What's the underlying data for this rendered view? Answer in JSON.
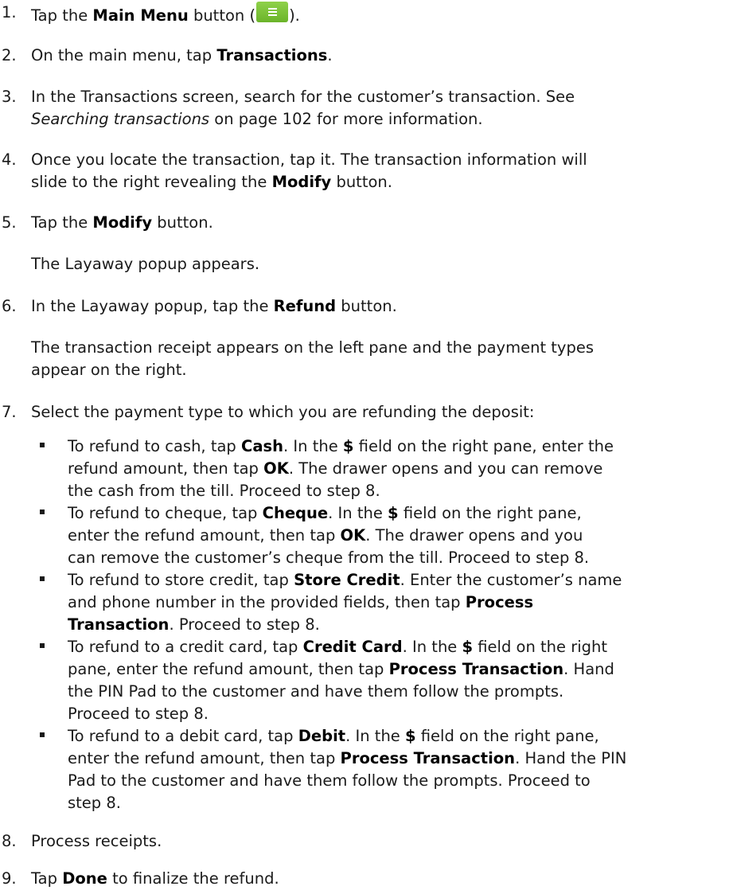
{
  "steps": {
    "s1": {
      "num": "1.",
      "a": "Tap the ",
      "b": "Main Menu",
      "c": " button (",
      "d": ")."
    },
    "s2": {
      "num": "2.",
      "a": "On the main menu, tap ",
      "b": "Transactions",
      "c": "."
    },
    "s3": {
      "num": "3.",
      "a": "In the Transactions screen, search for the customer’s transaction. See",
      "b": "Searching transactions",
      "c": " on page 102 for more information."
    },
    "s4": {
      "num": "4.",
      "a": "Once you locate the transaction, tap it. The transaction information will",
      "b": "slide to the right revealing the ",
      "c": "Modify",
      "d": " button."
    },
    "s5": {
      "num": "5.",
      "a": "Tap the ",
      "b": "Modify",
      "c": " button.",
      "note": "The Layaway popup appears."
    },
    "s6": {
      "num": "6.",
      "a": "In the Layaway popup, tap the ",
      "b": "Refund",
      "c": " button.",
      "note1": "The transaction receipt appears on the left pane and the payment types",
      "note2": "appear on the right."
    },
    "s7": {
      "num": "7.",
      "a": "Select the payment type to which you are refunding the deposit:"
    },
    "s8": {
      "num": "8.",
      "a": "Process receipts."
    },
    "s9": {
      "num": "9.",
      "a": "Tap ",
      "b": "Done",
      "c": " to finalize the refund."
    }
  },
  "bullets": {
    "cash": {
      "l1a": "To refund to cash, tap ",
      "l1b": "Cash",
      "l1c": ". In the ",
      "l1d": "$",
      "l1e": " field on the right pane, enter the",
      "l2a": "refund amount, then tap ",
      "l2b": "OK",
      "l2c": ". The drawer opens and you can remove",
      "l3": "the cash from the till. Proceed to step 8."
    },
    "cheque": {
      "l1a": "To refund to cheque, tap ",
      "l1b": "Cheque",
      "l1c": ". In the ",
      "l1d": "$",
      "l1e": " field on the right pane,",
      "l2a": "enter the refund amount, then tap ",
      "l2b": "OK",
      "l2c": ". The drawer opens and you",
      "l3": "can remove the customer’s cheque from the till. Proceed to step 8."
    },
    "store": {
      "l1a": "To refund to store credit, tap ",
      "l1b": "Store Credit",
      "l1c": ". Enter the customer’s name",
      "l2a": "and phone number in the provided fields, then tap ",
      "l2b": "Process",
      "l3a": "Transaction",
      "l3b": ". Proceed to step 8."
    },
    "credit": {
      "l1a": "To refund to a credit card, tap ",
      "l1b": "Credit Card",
      "l1c": ". In the ",
      "l1d": "$",
      "l1e": " field on the right",
      "l2a": "pane, enter the refund amount, then tap ",
      "l2b": "Process Transaction",
      "l2c": ". Hand",
      "l3": "the PIN Pad to the customer and have them follow the prompts.",
      "l4": "Proceed to step 8."
    },
    "debit": {
      "l1a": "To refund to a debit card, tap ",
      "l1b": "Debit",
      "l1c": ". In the ",
      "l1d": "$",
      "l1e": " field on the right pane,",
      "l2a": "enter the refund amount, then tap ",
      "l2b": "Process Transaction",
      "l2c": ". Hand the PIN",
      "l3": "Pad to the customer and have them follow the prompts. Proceed to",
      "l4": "step 8."
    }
  },
  "icons": {
    "main_menu": "hamburger-menu-icon",
    "accent": "#7ac143"
  }
}
